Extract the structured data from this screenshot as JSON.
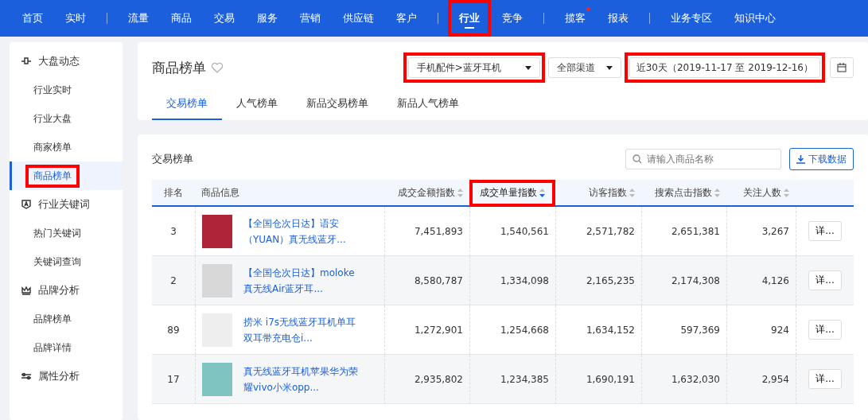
{
  "top_nav": {
    "groups": [
      [
        {
          "label": "首页",
          "selected": false,
          "dot": false,
          "highlighted": false
        },
        {
          "label": "实时",
          "selected": false,
          "dot": false,
          "highlighted": false
        }
      ],
      [
        {
          "label": "流量",
          "selected": false,
          "dot": false,
          "highlighted": false
        },
        {
          "label": "商品",
          "selected": false,
          "dot": false,
          "highlighted": false
        },
        {
          "label": "交易",
          "selected": false,
          "dot": false,
          "highlighted": false
        },
        {
          "label": "服务",
          "selected": false,
          "dot": false,
          "highlighted": false
        },
        {
          "label": "营销",
          "selected": false,
          "dot": false,
          "highlighted": false
        },
        {
          "label": "供应链",
          "selected": false,
          "dot": false,
          "highlighted": false
        },
        {
          "label": "客户",
          "selected": false,
          "dot": false,
          "highlighted": false
        }
      ],
      [
        {
          "label": "行业",
          "selected": true,
          "dot": false,
          "highlighted": true
        },
        {
          "label": "竞争",
          "selected": false,
          "dot": false,
          "highlighted": false
        }
      ],
      [
        {
          "label": "揽客",
          "selected": false,
          "dot": true,
          "highlighted": false
        },
        {
          "label": "报表",
          "selected": false,
          "dot": false,
          "highlighted": false
        }
      ],
      [
        {
          "label": "业务专区",
          "selected": false,
          "dot": false,
          "highlighted": false
        },
        {
          "label": "知识中心",
          "selected": false,
          "dot": false,
          "highlighted": false
        }
      ]
    ]
  },
  "sidebar": {
    "sections": [
      {
        "title": "大盘动态",
        "children": [
          {
            "label": "行业实时",
            "selected": false,
            "highlighted": false
          },
          {
            "label": "行业大盘",
            "selected": false,
            "highlighted": false
          },
          {
            "label": "商家榜单",
            "selected": false,
            "highlighted": false
          },
          {
            "label": "商品榜单",
            "selected": true,
            "highlighted": true
          }
        ]
      },
      {
        "title": "行业关键词",
        "children": [
          {
            "label": "热门关键词",
            "selected": false,
            "highlighted": false
          },
          {
            "label": "关键词查询",
            "selected": false,
            "highlighted": false
          }
        ]
      },
      {
        "title": "品牌分析",
        "children": [
          {
            "label": "品牌榜单",
            "selected": false,
            "highlighted": false
          },
          {
            "label": "品牌详情",
            "selected": false,
            "highlighted": false
          }
        ]
      },
      {
        "title": "属性分析"
      }
    ]
  },
  "header": {
    "title": "商品榜单",
    "category": {
      "value": "手机配件>蓝牙耳机",
      "highlighted": true
    },
    "channel": {
      "value": "全部渠道"
    },
    "date_range": {
      "value": "近30天（2019-11-17 至 2019-12-16）",
      "highlighted": true
    },
    "tabs": [
      {
        "label": "交易榜单",
        "selected": true
      },
      {
        "label": "人气榜单",
        "selected": false
      },
      {
        "label": "新品交易榜单",
        "selected": false
      },
      {
        "label": "新品人气榜单",
        "selected": false
      }
    ]
  },
  "table_card": {
    "title": "交易榜单",
    "search": {
      "placeholder": "请输入商品名称"
    },
    "download_button": "下载数据",
    "columns": [
      {
        "label": "排名",
        "sortable": false,
        "highlighted": false
      },
      {
        "label": "商品信息",
        "sortable": false,
        "highlighted": false
      },
      {
        "label": "成交金额指数",
        "sortable": true,
        "sorted": false,
        "highlighted": false
      },
      {
        "label": "成交单量指数",
        "sortable": true,
        "sorted": true,
        "highlighted": true
      },
      {
        "label": "访客指数",
        "sortable": true,
        "sorted": false,
        "highlighted": false
      },
      {
        "label": "搜索点击指数",
        "sortable": true,
        "sorted": false,
        "highlighted": false
      },
      {
        "label": "关注人数",
        "sortable": true,
        "sorted": false,
        "highlighted": false
      }
    ],
    "rows": [
      {
        "rank": "3",
        "product": "【全国仓次日达】语安（YUAN）真无线蓝牙...",
        "values": [
          "7,451,893",
          "1,540,561",
          "2,571,782",
          "2,651,381",
          "3,267"
        ],
        "action": "详..."
      },
      {
        "rank": "2",
        "product": "【全国仓次日达】moloke真无线Air蓝牙耳...",
        "values": [
          "8,580,787",
          "1,334,098",
          "2,165,235",
          "2,174,308",
          "4,126"
        ],
        "action": "详..."
      },
      {
        "rank": "89",
        "product": "捞米 i7s无线蓝牙耳机单耳双耳带充电仓i...",
        "values": [
          "1,272,901",
          "1,254,668",
          "1,634,152",
          "597,369",
          "924"
        ],
        "action": "详..."
      },
      {
        "rank": "17",
        "product": "真无线蓝牙耳机苹果华为荣耀vivo小米opp...",
        "values": [
          "2,935,802",
          "1,234,385",
          "1,690,191",
          "1,632,030",
          "2,954"
        ],
        "action": "详..."
      }
    ]
  }
}
